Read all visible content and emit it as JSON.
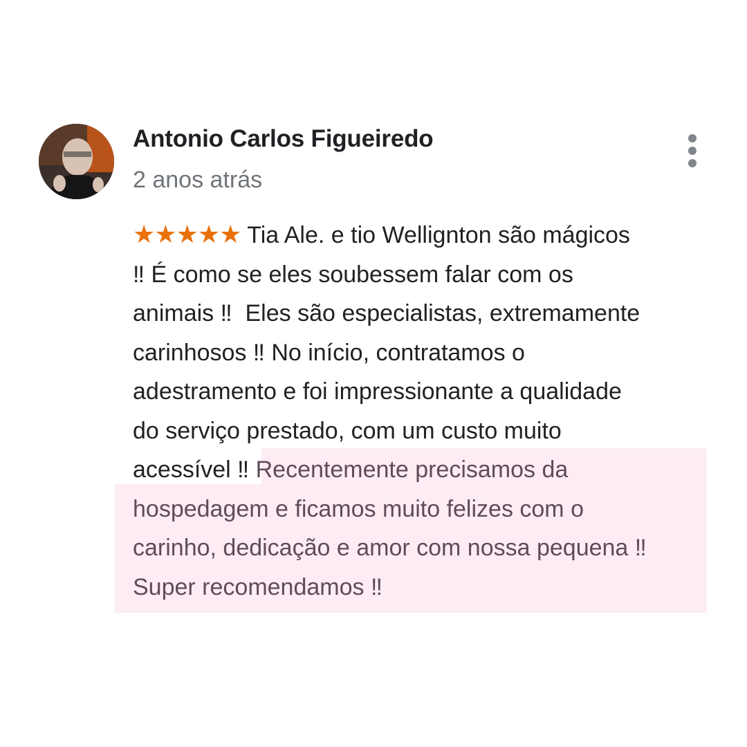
{
  "review": {
    "author_name": "Antonio Carlos Figueiredo",
    "time_ago": "2 anos atrás",
    "rating": 5,
    "stars": "★★★★★",
    "star_color": "#e8710a",
    "highlight_color": "#fdecf4",
    "text_lines": [
      " Tia Ale. e tio Wellignton são mágicos",
      "‼ É como se eles soubessem falar com os",
      "animais ‼  Eles são especialistas, extremamente",
      "carinhosos ‼ No início, contratamos o",
      "adestramento e foi impressionante a qualidade",
      "do serviço prestado, com um custo muito",
      "acessível ‼ "
    ],
    "highlighted_lines": [
      "Recentemente precisamos da",
      "hospedagem e ficamos muito felizes com o",
      "carinho, dedicação e amor com nossa pequena ‼",
      "Super recomendamos ‼"
    ],
    "more_icon": "more-vert-icon"
  }
}
